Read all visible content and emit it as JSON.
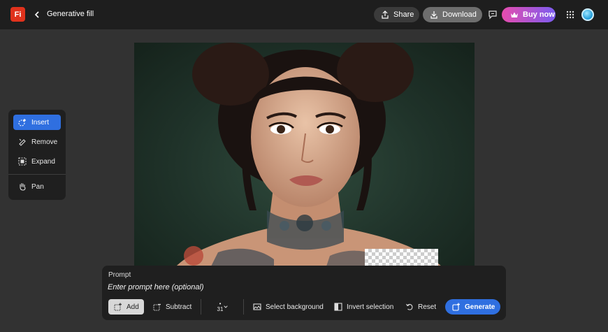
{
  "header": {
    "logo_text": "Fi",
    "title": "Generative fill",
    "share_label": "Share",
    "download_label": "Download",
    "buynow_label": "Buy now"
  },
  "tools": [
    {
      "label": "Insert",
      "icon": "insert-icon",
      "active": true
    },
    {
      "label": "Remove",
      "icon": "remove-icon",
      "active": false
    },
    {
      "label": "Expand",
      "icon": "expand-icon",
      "active": false
    },
    {
      "label": "Pan",
      "icon": "hand-icon",
      "active": false
    }
  ],
  "prompt": {
    "label": "Prompt",
    "placeholder": "Enter prompt here (optional)"
  },
  "bottom": {
    "add_label": "Add",
    "subtract_label": "Subtract",
    "brush_size": "31",
    "select_background_label": "Select background",
    "invert_selection_label": "Invert selection",
    "reset_label": "Reset",
    "generate_label": "Generate"
  },
  "colors": {
    "accent": "#2f6fe0",
    "logo": "#e0321c",
    "buynow_start": "#e64cae",
    "buynow_end": "#7b5cf0"
  }
}
